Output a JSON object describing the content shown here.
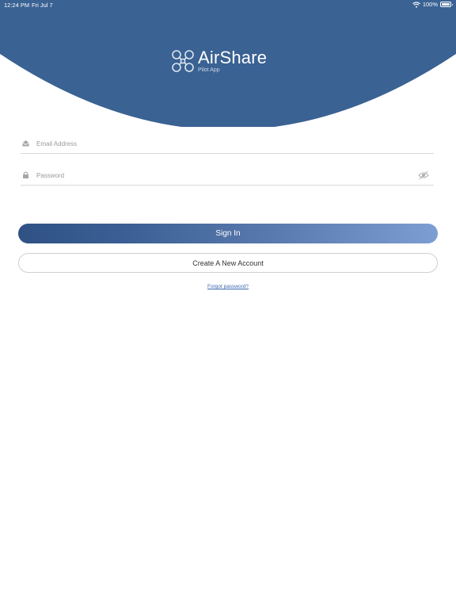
{
  "status_bar": {
    "time": "12:24 PM",
    "date": "Fri Jul 7",
    "battery": "100%"
  },
  "brand": {
    "name": "AirShare",
    "subtitle": "Pilot App",
    "header_color": "#3a6293"
  },
  "form": {
    "email": {
      "placeholder": "Email Address",
      "value": ""
    },
    "password": {
      "placeholder": "Password",
      "value": ""
    }
  },
  "actions": {
    "sign_in": "Sign In",
    "create_account": "Create A New Account",
    "forgot_password": "Forgot password?"
  },
  "icons": [
    "wifi-icon",
    "battery-icon",
    "drone-icon",
    "mail-icon",
    "lock-icon",
    "eye-off-icon"
  ]
}
